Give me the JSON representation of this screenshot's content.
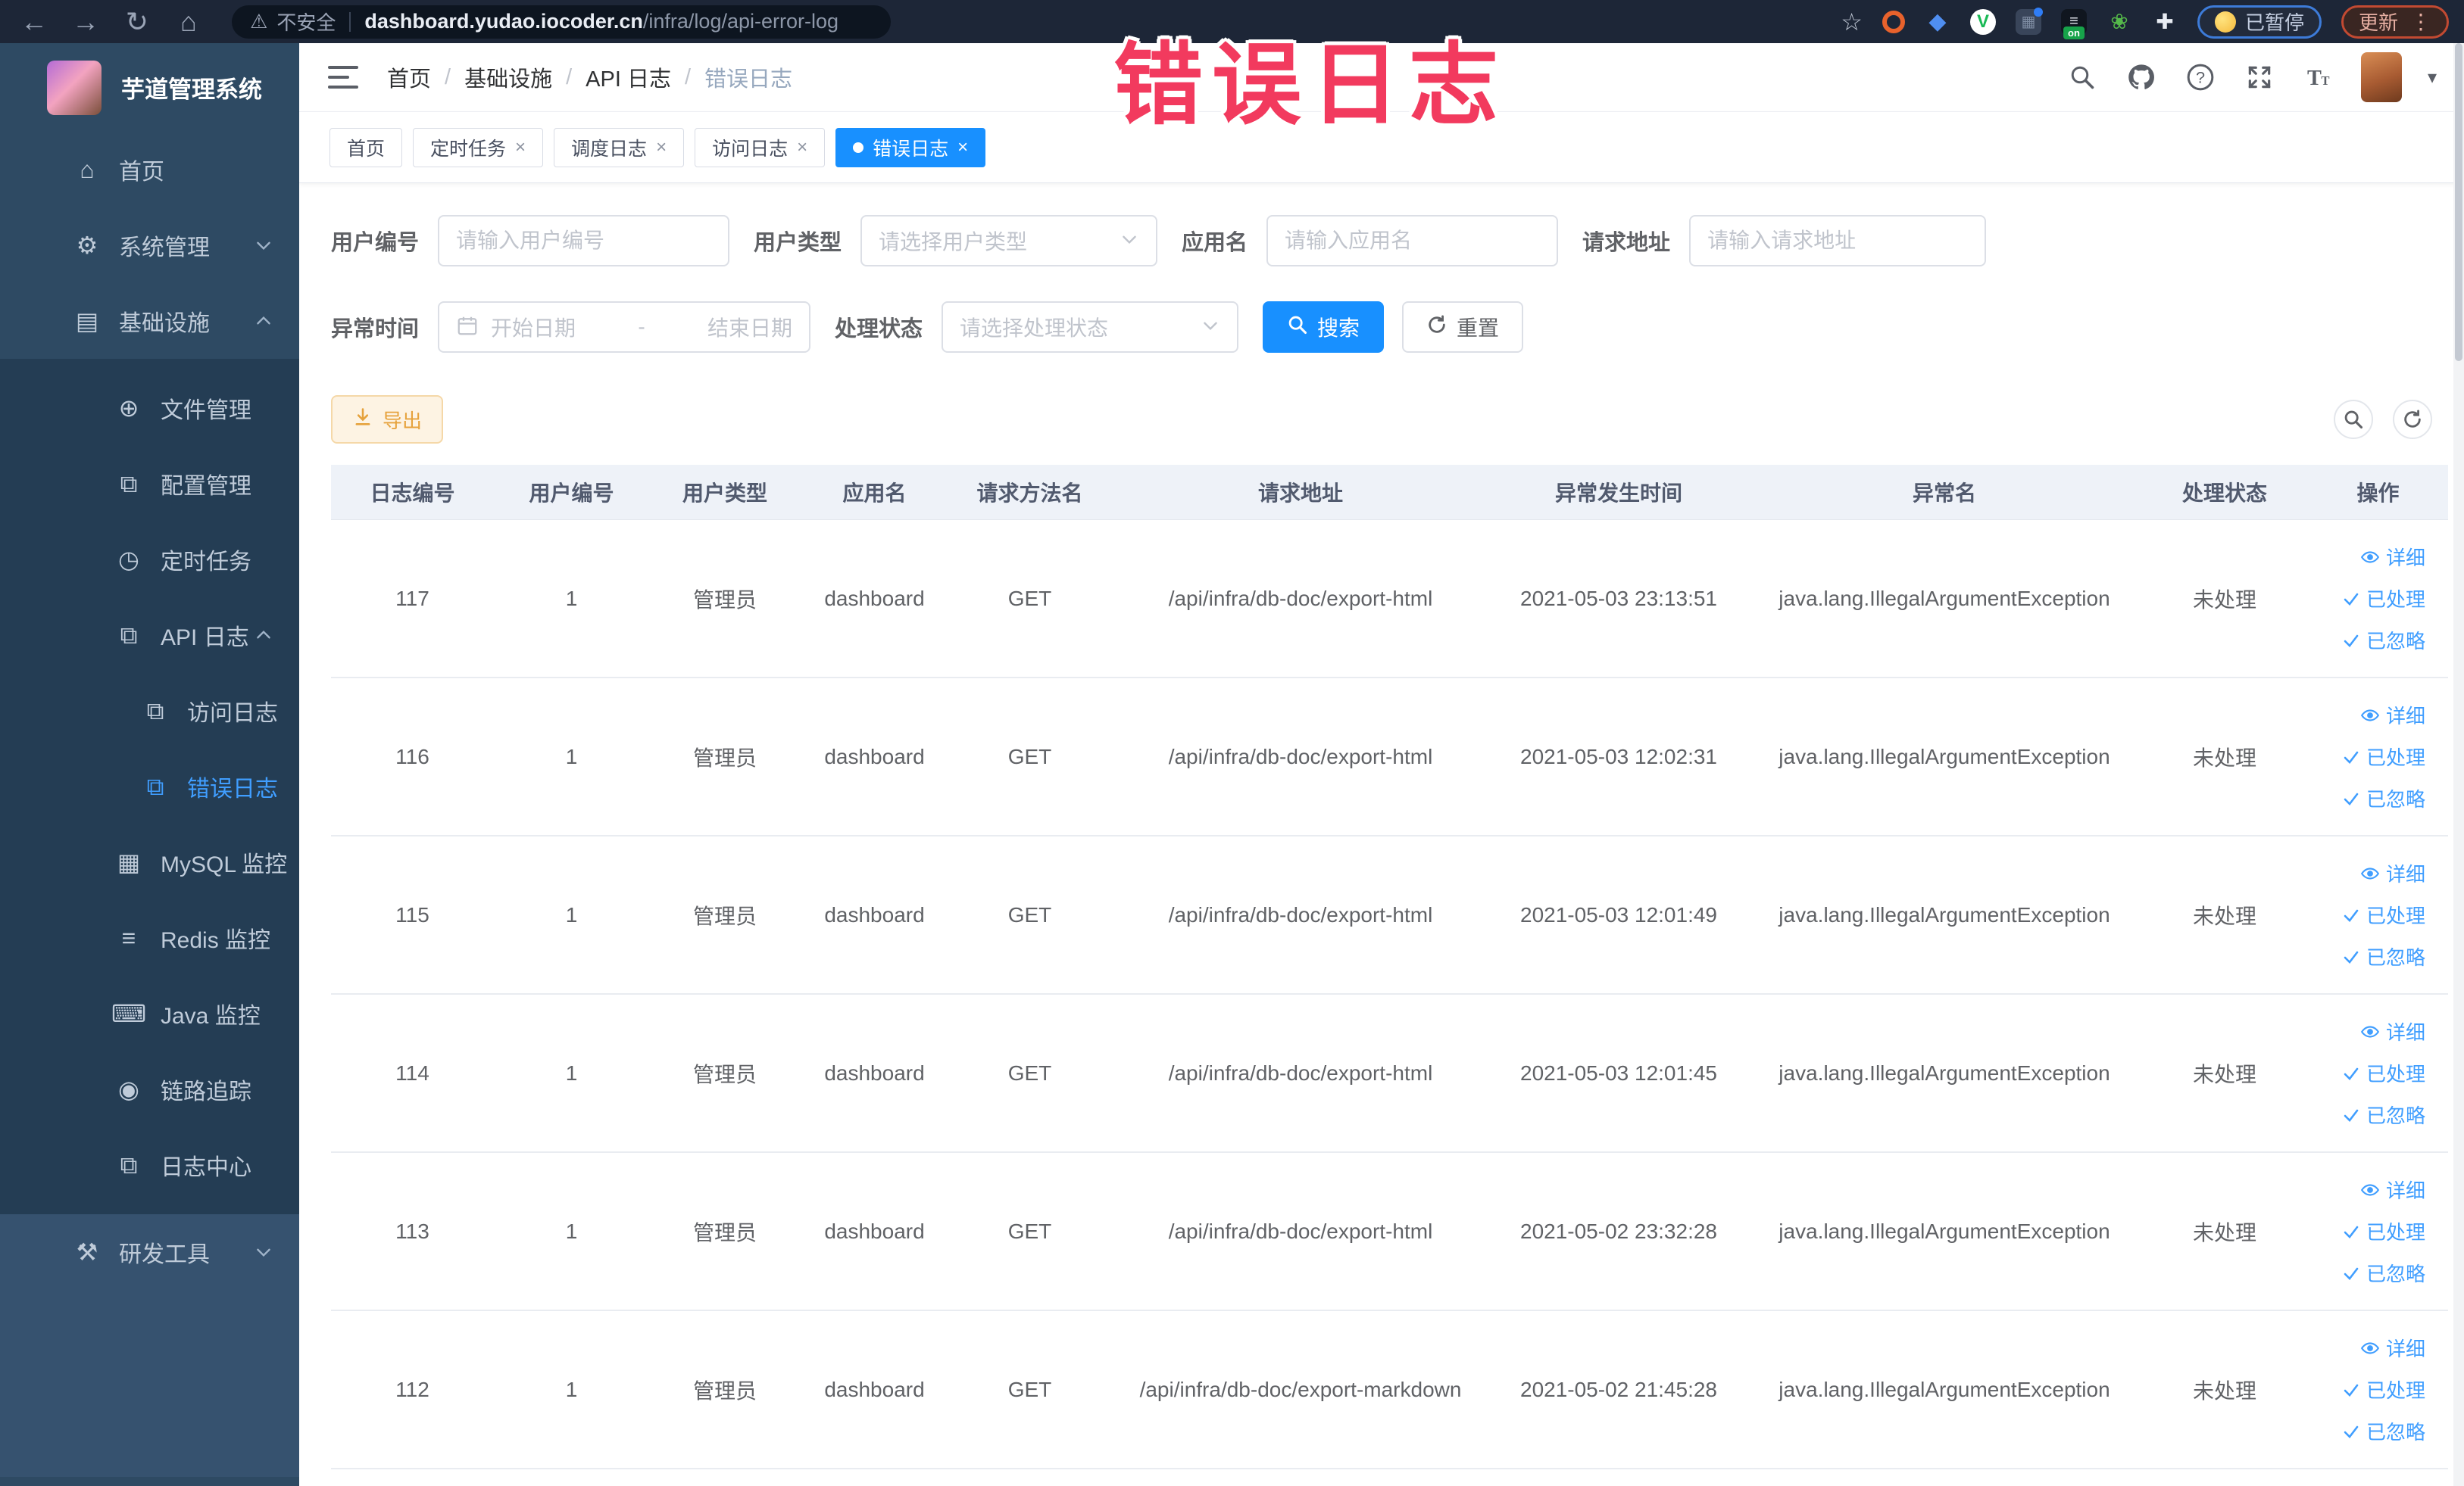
{
  "browser": {
    "security_label": "不安全",
    "url_host": "dashboard.yudao.iocoder.cn",
    "url_path": "/infra/log/api-error-log",
    "paused_badge": "已暂停",
    "update_badge": "更新"
  },
  "annotation": {
    "text": "错误日志",
    "color": "#f23a5e"
  },
  "sidebar": {
    "title": "芋道管理系统",
    "items": [
      {
        "name": "home",
        "label": "首页",
        "glyph": "⌂",
        "depth": 0,
        "section": "top"
      },
      {
        "name": "system-management",
        "label": "系统管理",
        "glyph": "⚙",
        "depth": 0,
        "section": "top",
        "chevron": "down"
      },
      {
        "name": "infrastructure",
        "label": "基础设施",
        "glyph": "▤",
        "depth": 0,
        "section": "top",
        "chevron": "up"
      },
      {
        "name": "file-management",
        "label": "文件管理",
        "glyph": "⊕",
        "depth": 1,
        "section": "sub"
      },
      {
        "name": "config-management",
        "label": "配置管理",
        "glyph": "⧉",
        "depth": 1,
        "section": "sub"
      },
      {
        "name": "scheduled-jobs",
        "label": "定时任务",
        "glyph": "◷",
        "depth": 1,
        "section": "sub"
      },
      {
        "name": "api-log",
        "label": "API 日志",
        "glyph": "⧉",
        "depth": 1,
        "section": "sub",
        "chevron": "up"
      },
      {
        "name": "access-log",
        "label": "访问日志",
        "glyph": "⧉",
        "depth": 2,
        "section": "sub"
      },
      {
        "name": "error-log",
        "label": "错误日志",
        "glyph": "⧉",
        "depth": 2,
        "section": "sub",
        "active": true
      },
      {
        "name": "mysql-monitor",
        "label": "MySQL 监控",
        "glyph": "▦",
        "depth": 1,
        "section": "sub"
      },
      {
        "name": "redis-monitor",
        "label": "Redis 监控",
        "glyph": "≡",
        "depth": 1,
        "section": "sub"
      },
      {
        "name": "java-monitor",
        "label": "Java 监控",
        "glyph": "⌨",
        "depth": 1,
        "section": "sub"
      },
      {
        "name": "trace",
        "label": "链路追踪",
        "glyph": "◉",
        "depth": 1,
        "section": "sub"
      },
      {
        "name": "log-center",
        "label": "日志中心",
        "glyph": "⧉",
        "depth": 1,
        "section": "sub"
      },
      {
        "name": "dev-tools",
        "label": "研发工具",
        "glyph": "⚒",
        "depth": 0,
        "section": "bottom",
        "chevron": "down"
      }
    ]
  },
  "header": {
    "breadcrumb": [
      "首页",
      "基础设施",
      "API 日志",
      "错误日志"
    ]
  },
  "tabs": [
    {
      "name": "tab-home",
      "label": "首页",
      "closable": false,
      "active": false
    },
    {
      "name": "tab-job",
      "label": "定时任务",
      "closable": true,
      "active": false
    },
    {
      "name": "tab-job-log",
      "label": "调度日志",
      "closable": true,
      "active": false
    },
    {
      "name": "tab-access-log",
      "label": "访问日志",
      "closable": true,
      "active": false
    },
    {
      "name": "tab-error-log",
      "label": "错误日志",
      "closable": true,
      "active": true
    }
  ],
  "filters": {
    "user_id": {
      "label": "用户编号",
      "placeholder": "请输入用户编号"
    },
    "user_type": {
      "label": "用户类型",
      "placeholder": "请选择用户类型"
    },
    "app_name": {
      "label": "应用名",
      "placeholder": "请输入应用名"
    },
    "request_url": {
      "label": "请求地址",
      "placeholder": "请输入请求地址"
    },
    "exception_time": {
      "label": "异常时间",
      "start_placeholder": "开始日期",
      "separator": "-",
      "end_placeholder": "结束日期"
    },
    "process_status": {
      "label": "处理状态",
      "placeholder": "请选择处理状态"
    },
    "search_label": "搜索",
    "reset_label": "重置"
  },
  "toolbar": {
    "export_label": "导出"
  },
  "table": {
    "columns": [
      "日志编号",
      "用户编号",
      "用户类型",
      "应用名",
      "请求方法名",
      "请求地址",
      "异常发生时间",
      "异常名",
      "处理状态",
      "操作"
    ],
    "row_actions": [
      "详细",
      "已处理",
      "已忽略"
    ],
    "rows": [
      {
        "id": "117",
        "user_id": "1",
        "user_type": "管理员",
        "app": "dashboard",
        "method": "GET",
        "url": "/api/infra/db-doc/export-html",
        "time": "2021-05-03 23:13:51",
        "exception": "java.lang.IllegalArgumentException",
        "status": "未处理"
      },
      {
        "id": "116",
        "user_id": "1",
        "user_type": "管理员",
        "app": "dashboard",
        "method": "GET",
        "url": "/api/infra/db-doc/export-html",
        "time": "2021-05-03 12:02:31",
        "exception": "java.lang.IllegalArgumentException",
        "status": "未处理"
      },
      {
        "id": "115",
        "user_id": "1",
        "user_type": "管理员",
        "app": "dashboard",
        "method": "GET",
        "url": "/api/infra/db-doc/export-html",
        "time": "2021-05-03 12:01:49",
        "exception": "java.lang.IllegalArgumentException",
        "status": "未处理"
      },
      {
        "id": "114",
        "user_id": "1",
        "user_type": "管理员",
        "app": "dashboard",
        "method": "GET",
        "url": "/api/infra/db-doc/export-html",
        "time": "2021-05-03 12:01:45",
        "exception": "java.lang.IllegalArgumentException",
        "status": "未处理"
      },
      {
        "id": "113",
        "user_id": "1",
        "user_type": "管理员",
        "app": "dashboard",
        "method": "GET",
        "url": "/api/infra/db-doc/export-html",
        "time": "2021-05-02 23:32:28",
        "exception": "java.lang.IllegalArgumentException",
        "status": "未处理"
      },
      {
        "id": "112",
        "user_id": "1",
        "user_type": "管理员",
        "app": "dashboard",
        "method": "GET",
        "url": "/api/infra/db-doc/export-markdown",
        "time": "2021-05-02 21:45:28",
        "exception": "java.lang.IllegalArgumentException",
        "status": "未处理"
      }
    ]
  },
  "colors": {
    "accent_blue": "#1890ff",
    "link_blue": "#409eff",
    "export_orange": "#e6a23c",
    "annotation_red": "#f23a5e",
    "sidebar_bg": "#2e4a63",
    "sidebar_sub_bg": "#243d54"
  }
}
